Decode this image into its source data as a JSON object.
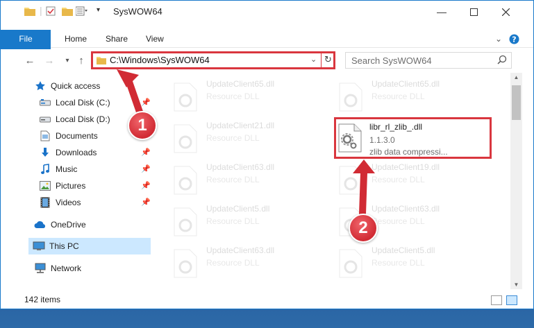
{
  "window": {
    "title": "SysWOW64"
  },
  "ribbon": {
    "tabs": [
      "File",
      "Home",
      "Share",
      "View"
    ]
  },
  "address": {
    "path": "C:\\Windows\\SysWOW64"
  },
  "search": {
    "placeholder": "Search SysWOW64"
  },
  "sidebar": {
    "quick_access": "Quick access",
    "items": [
      {
        "label": "Local Disk (C:)",
        "icon": "drive-icon",
        "pinned": true
      },
      {
        "label": "Local Disk (D:)",
        "icon": "drive-icon",
        "pinned": false
      },
      {
        "label": "Documents",
        "icon": "documents-icon",
        "pinned": true
      },
      {
        "label": "Downloads",
        "icon": "download-icon",
        "pinned": true
      },
      {
        "label": "Music",
        "icon": "music-icon",
        "pinned": true
      },
      {
        "label": "Pictures",
        "icon": "pictures-icon",
        "pinned": true
      },
      {
        "label": "Videos",
        "icon": "videos-icon",
        "pinned": true
      }
    ],
    "onedrive": "OneDrive",
    "this_pc": "This PC",
    "network": "Network"
  },
  "files": [
    {
      "name": "UpdateClient65.dll",
      "type": "Resource DLL"
    },
    {
      "name": "UpdateClient65.dll",
      "type": "Resource DLL"
    },
    {
      "name": "UpdateClient21.dll",
      "type": "Resource DLL"
    },
    {
      "name": "libr_rl_zlib_.dll",
      "version": "1.1.3.0",
      "description": "zlib data compressi..."
    },
    {
      "name": "UpdateClient63.dll",
      "type": "Resource DLL"
    },
    {
      "name": "UpdateClient19.dll",
      "type": "Resource DLL"
    },
    {
      "name": "UpdateClient5.dll",
      "type": "Resource DLL"
    },
    {
      "name": "UpdateClient63.dll",
      "type": "Resource DLL"
    },
    {
      "name": "UpdateClient63.dll",
      "type": "Resource DLL"
    },
    {
      "name": "UpdateClient5.dll",
      "type": "Resource DLL"
    }
  ],
  "status": {
    "item_count": "142 items"
  },
  "callouts": [
    "1",
    "2"
  ],
  "colors": {
    "accent": "#1979ca",
    "highlight": "#d9363e",
    "selected": "#cce8ff"
  }
}
